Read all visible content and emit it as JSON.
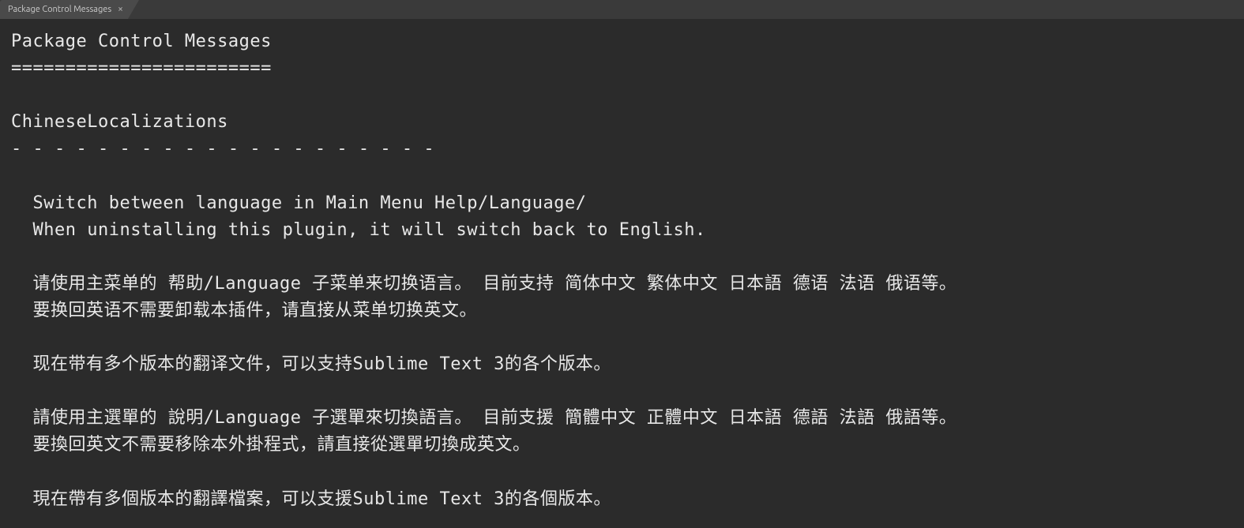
{
  "tab": {
    "title": "Package Control Messages",
    "close_glyph": "×"
  },
  "content": {
    "line1": "Package Control Messages",
    "line2": "========================",
    "line3": "",
    "line4": "ChineseLocalizations",
    "line5": "- - - - - - - - - - - - - - - - - - - -",
    "line6": "",
    "line7": "  Switch between language in Main Menu Help/Language/",
    "line8": "  When uninstalling this plugin, it will switch back to English.",
    "line9": "",
    "line10": "  请使用主菜单的 帮助/Language 子菜单来切换语言。 目前支持 简体中文 繁体中文 日本語 德语 法语 俄语等。",
    "line11": "  要换回英语不需要卸载本插件，请直接从菜单切换英文。",
    "line12": "",
    "line13": "  现在带有多个版本的翻译文件，可以支持Sublime Text 3的各个版本。",
    "line14": "",
    "line15": "  請使用主選單的 說明/Language 子選單來切換語言。 目前支援 簡體中文 正體中文 日本語 德語 法語 俄語等。",
    "line16": "  要換回英文不需要移除本外掛程式，請直接從選單切換成英文。",
    "line17": "",
    "line18": "  現在帶有多個版本的翻譯檔案，可以支援Sublime Text 3的各個版本。"
  }
}
